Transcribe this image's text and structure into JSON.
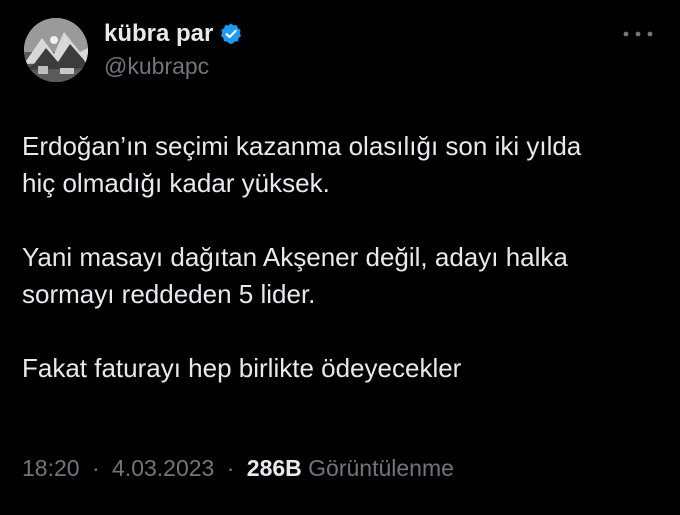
{
  "author": {
    "display_name": "kübra par",
    "handle": "@kubrapc",
    "verified": true,
    "avatar_icon": "avatar-photo-icon"
  },
  "tweet": {
    "paragraphs": [
      "Erdoğan’ın seçimi kazanma olasılığı son iki yılda\nhiç olmadığı kadar yüksek.",
      "Yani masayı dağıtan Akşener değil, adayı halka\nsormayı reddeden 5 lider.",
      "Fakat faturayı hep birlikte ödeyecekler"
    ]
  },
  "meta": {
    "time": "18:20",
    "separator": "·",
    "date": "4.03.2023",
    "views_count": "286B",
    "views_label": "Görüntülenme"
  },
  "colors": {
    "background": "#000000",
    "text_primary": "#e7e9ea",
    "text_secondary": "#71767b",
    "verified_blue": "#1d9bf0"
  },
  "icons": {
    "verified": "verified-badge-icon",
    "more": "more-options-icon"
  }
}
